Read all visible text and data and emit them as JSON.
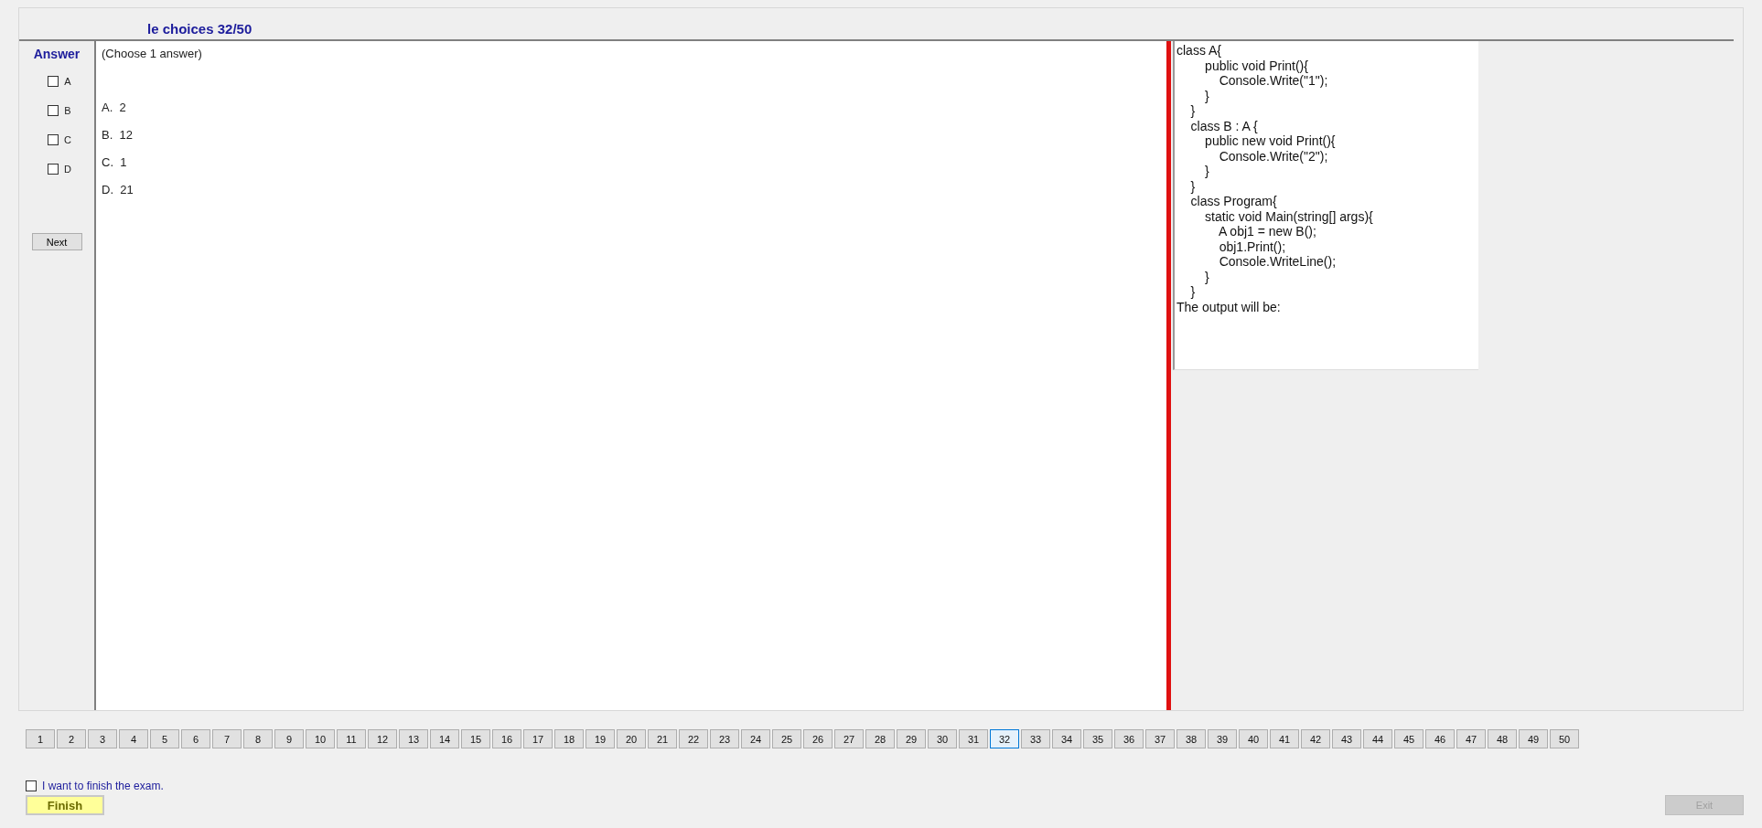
{
  "title": "le choices 32/50",
  "answer_panel": {
    "heading": "Answer",
    "choices": [
      {
        "label": "A",
        "checked": false
      },
      {
        "label": "B",
        "checked": false
      },
      {
        "label": "C",
        "checked": false
      },
      {
        "label": "D",
        "checked": false
      }
    ],
    "next_button": "Next"
  },
  "question": {
    "instruction": "(Choose 1 answer)",
    "options": [
      "A.  2",
      "B.  12",
      "C.  1",
      "D.  21"
    ]
  },
  "code_panel": {
    "lines": [
      "class A{",
      "        public void Print(){",
      "            Console.Write(\"1\");",
      "        }",
      "    }",
      "    class B : A {",
      "        public new void Print(){",
      "            Console.Write(\"2\");",
      "        }",
      "    }",
      "    class Program{",
      "        static void Main(string[] args){",
      "            A obj1 = new B();",
      "            obj1.Print();",
      "            Console.WriteLine();",
      "        }",
      "    }",
      "The output will be:"
    ]
  },
  "question_nav": [
    {
      "label": "1",
      "selected": false
    },
    {
      "label": "2",
      "selected": false
    },
    {
      "label": "3",
      "selected": false
    },
    {
      "label": "4",
      "selected": false
    },
    {
      "label": "5",
      "selected": false
    },
    {
      "label": "6",
      "selected": false
    },
    {
      "label": "7",
      "selected": false
    },
    {
      "label": "8",
      "selected": false
    },
    {
      "label": "9",
      "selected": false
    },
    {
      "label": "10",
      "selected": false
    },
    {
      "label": "11",
      "selected": false
    },
    {
      "label": "12",
      "selected": false
    },
    {
      "label": "13",
      "selected": false
    },
    {
      "label": "14",
      "selected": false
    },
    {
      "label": "15",
      "selected": false
    },
    {
      "label": "16",
      "selected": false
    },
    {
      "label": "17",
      "selected": false
    },
    {
      "label": "18",
      "selected": false
    },
    {
      "label": "19",
      "selected": false
    },
    {
      "label": "20",
      "selected": false
    },
    {
      "label": "21",
      "selected": false
    },
    {
      "label": "22",
      "selected": false
    },
    {
      "label": "23",
      "selected": false
    },
    {
      "label": "24",
      "selected": false
    },
    {
      "label": "25",
      "selected": false
    },
    {
      "label": "26",
      "selected": false
    },
    {
      "label": "27",
      "selected": false
    },
    {
      "label": "28",
      "selected": false
    },
    {
      "label": "29",
      "selected": false
    },
    {
      "label": "30",
      "selected": false
    },
    {
      "label": "31",
      "selected": false
    },
    {
      "label": "32",
      "selected": true
    },
    {
      "label": "33",
      "selected": false
    },
    {
      "label": "34",
      "selected": false
    },
    {
      "label": "35",
      "selected": false
    },
    {
      "label": "36",
      "selected": false
    },
    {
      "label": "37",
      "selected": false
    },
    {
      "label": "38",
      "selected": false
    },
    {
      "label": "39",
      "selected": false
    },
    {
      "label": "40",
      "selected": false
    },
    {
      "label": "41",
      "selected": false
    },
    {
      "label": "42",
      "selected": false
    },
    {
      "label": "43",
      "selected": false
    },
    {
      "label": "44",
      "selected": false
    },
    {
      "label": "45",
      "selected": false
    },
    {
      "label": "46",
      "selected": false
    },
    {
      "label": "47",
      "selected": false
    },
    {
      "label": "48",
      "selected": false
    },
    {
      "label": "49",
      "selected": false
    },
    {
      "label": "50",
      "selected": false
    }
  ],
  "finish_confirm": {
    "label": "I want to finish the exam.",
    "checked": false
  },
  "finish_button": "Finish",
  "exit_button": {
    "label": "Exit",
    "disabled": true
  }
}
